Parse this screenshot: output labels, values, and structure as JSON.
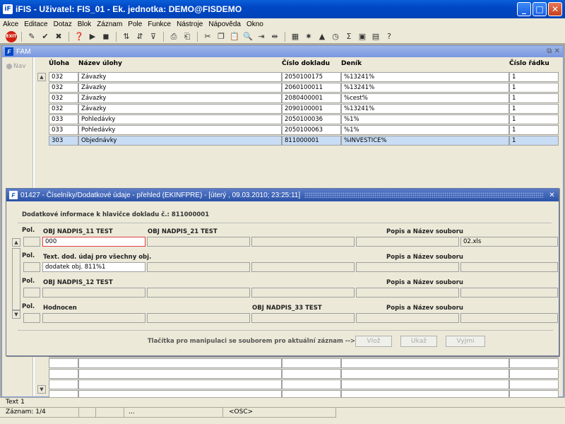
{
  "window": {
    "title": "iFIS - Uživatel: FIS_01 - Ek. jednotka: DEMO@FISDEMO",
    "app_icon": "iF"
  },
  "menu": [
    "Akce",
    "Editace",
    "Dotaz",
    "Blok",
    "Záznam",
    "Pole",
    "Funkce",
    "Nástroje",
    "Nápověda",
    "Okno"
  ],
  "toolbar": {
    "exit_label": "EXIT"
  },
  "back_window": {
    "title": "FAM",
    "nav_label": "Nav",
    "columns": [
      "Úloha",
      "Název úlohy",
      "Číslo dokladu",
      "Deník",
      "Číslo řádku"
    ],
    "rows": [
      [
        "032",
        "Závazky",
        "2050100175",
        "%13241%",
        "1"
      ],
      [
        "032",
        "Závazky",
        "2060100011",
        "%13241%",
        "1"
      ],
      [
        "032",
        "Závazky",
        "2080400001",
        "%cest%",
        "1"
      ],
      [
        "032",
        "Závazky",
        "2090100001",
        "%13241%",
        "1"
      ],
      [
        "033",
        "Pohledávky",
        "2050100036",
        "%1%",
        "1"
      ],
      [
        "033",
        "Pohledávky",
        "2050100063",
        "%1%",
        "1"
      ],
      [
        "303",
        "Objednávky",
        "811000001",
        "%INVESTICE%",
        "1"
      ]
    ],
    "selected_row": 6
  },
  "dialog": {
    "title": "01427 - Číselníky/Dodatkové údaje - přehled (EKINFPRE) - [úterý , 09.03.2010; 23:25:11]",
    "heading": "Dodatkové informace k hlavičce dokladu č.: 811000001",
    "pol_label": "Pol.",
    "popis_label": "Popis a Název souboru",
    "sections": [
      {
        "label1": "OBJ NADPIS_11 TEST",
        "label2": "OBJ NADPIS_21 TEST",
        "label3": "",
        "value1": "000",
        "file": "02.xls"
      },
      {
        "label1": "Text. dod. údaj pro všechny obj.",
        "label2": "",
        "label3": "",
        "value1": "dodatek obj. 811%1",
        "file": ""
      },
      {
        "label1": "OBJ NADPIS_12 TEST",
        "label2": "",
        "label3": "",
        "value1": "",
        "file": ""
      },
      {
        "label1": "Hodnocen",
        "label2": "",
        "label3": "OBJ NADPIS_33 TEST",
        "value1": "",
        "file": ""
      }
    ],
    "footer_text": "Tlačítka pro manipulaci se souborem pro aktuální záznam -->",
    "buttons": {
      "insert": "Vlož",
      "show": "Ukaž",
      "remove": "Vyjmi"
    }
  },
  "status": {
    "line1": "Text 1",
    "record": "Záznam: 1/4",
    "ellipsis": "...",
    "mode": "<OSC>"
  }
}
